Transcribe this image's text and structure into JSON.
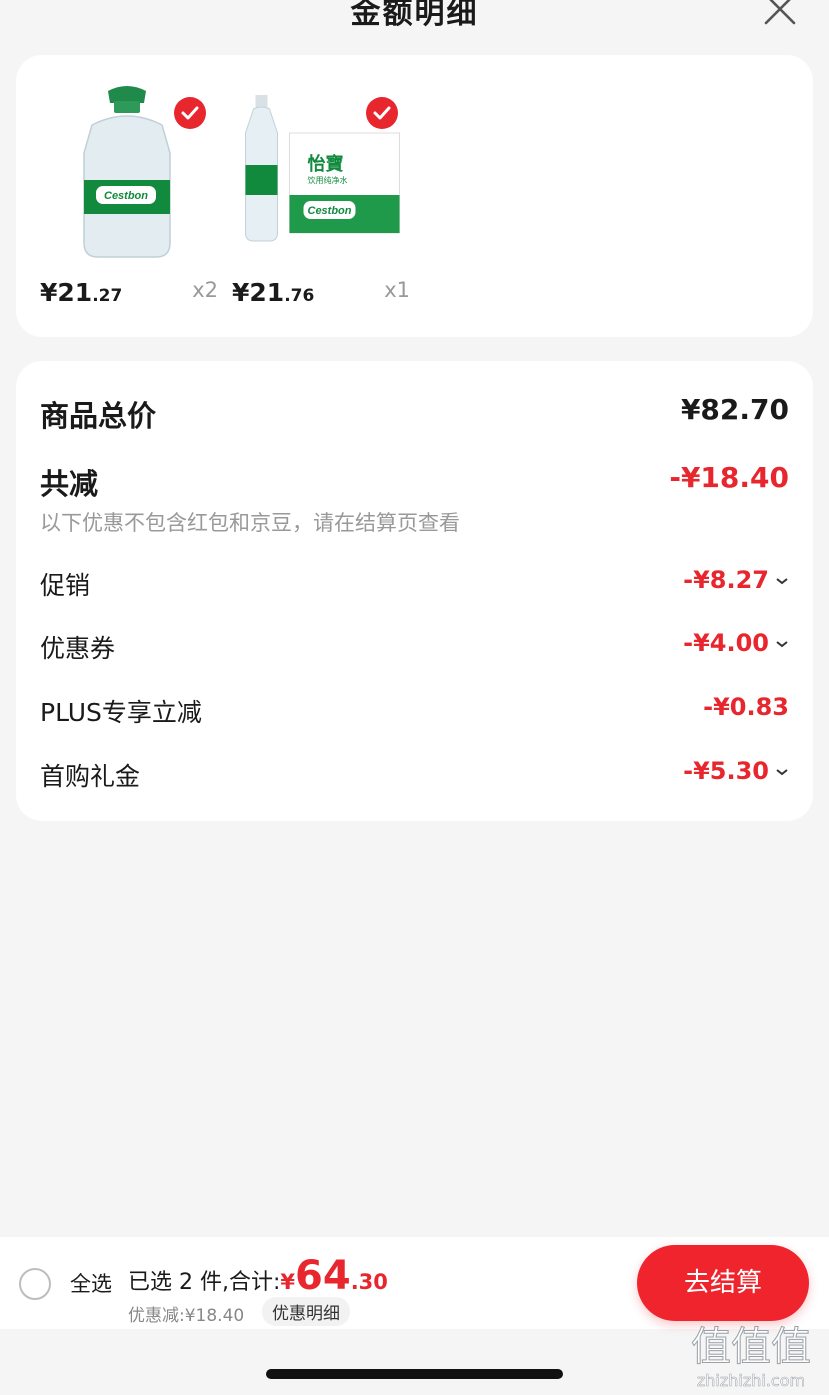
{
  "header": {
    "title": "金额明细"
  },
  "products": [
    {
      "price_int": "¥21",
      "price_dec": ".27",
      "qty": "x2",
      "selected": true,
      "image_icon": "cestbon-large-bottle-image",
      "brand_label": "Cestbon"
    },
    {
      "price_int": "¥21",
      "price_dec": ".76",
      "qty": "x1",
      "selected": true,
      "image_icon": "cestbon-bottle-case-image",
      "brand_label": "Cestbon",
      "brand_label_cn": "怡寶",
      "subtitle_cn": "饮用纯净水"
    }
  ],
  "details": {
    "total_label": "商品总价",
    "total_value": "¥82.70",
    "reduce_label": "共减",
    "reduce_value": "-¥18.40",
    "note": "以下优惠不包含红包和京豆，请在结算页查看",
    "items": [
      {
        "label": "促销",
        "value": "-¥8.27",
        "expandable": true
      },
      {
        "label": "优惠券",
        "value": "-¥4.00",
        "expandable": true
      },
      {
        "label": "PLUS专享立减",
        "value": "-¥0.83",
        "expandable": false
      },
      {
        "label": "首购礼金",
        "value": "-¥5.30",
        "expandable": true
      }
    ]
  },
  "bottom": {
    "select_all": "全选",
    "summary_prefix": "已选 2 件,合计:",
    "total_symbol": "¥",
    "total_int": "64",
    "total_dec": ".30",
    "discount": "优惠减:¥18.40",
    "discount_detail": "优惠明细",
    "checkout": "去结算"
  },
  "watermark": {
    "text": "值值值",
    "domain": "zhizhizhi.com"
  },
  "colors": {
    "accent": "#e8262e",
    "background": "#f5f5f5",
    "card": "#ffffff"
  }
}
